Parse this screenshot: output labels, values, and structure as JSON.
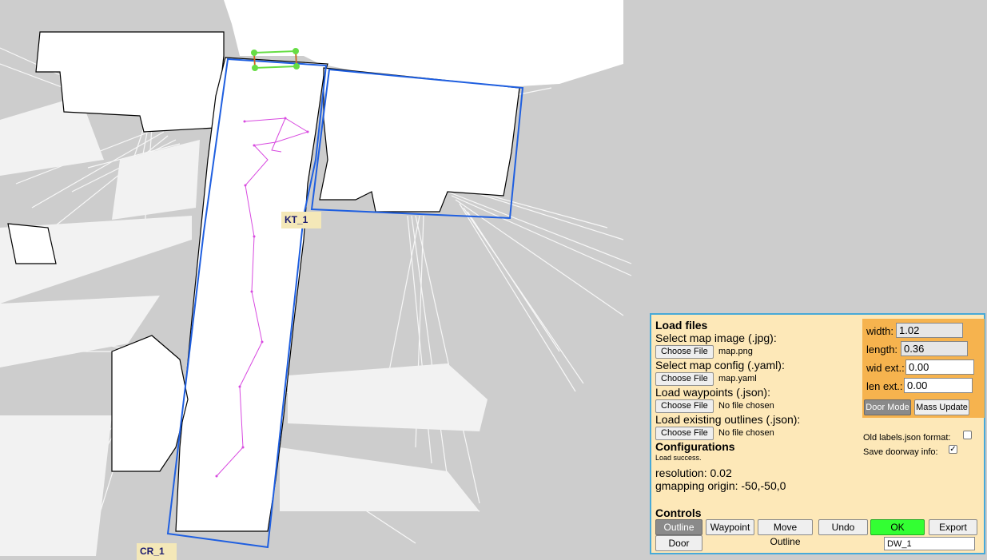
{
  "map": {
    "rooms": [
      {
        "label": "KT_1"
      },
      {
        "label": "CR_1"
      }
    ],
    "colors": {
      "outline": "#1f5fe0",
      "waypoints": "#d84ae0",
      "door": "#66dd44",
      "background": "#cdcdcd",
      "free_space": "#ffffff"
    }
  },
  "panel": {
    "load_files_title": "Load files",
    "map_image_label": "Select map image (.jpg):",
    "map_image_button": "Choose File",
    "map_image_file": "map.png",
    "map_config_label": "Select map config (.yaml):",
    "map_config_button": "Choose File",
    "map_config_file": "map.yaml",
    "waypoints_label": "Load waypoints (.json):",
    "waypoints_button": "Choose File",
    "waypoints_file": "No file chosen",
    "outlines_label": "Load existing outlines (.json):",
    "outlines_button": "Choose File",
    "outlines_file": "No file chosen",
    "config_title": "Configurations",
    "load_status": "Load success.",
    "resolution": "resolution: 0.02",
    "gmapping_origin": "gmapping origin: -50,-50,0",
    "controls_title": "Controls",
    "door": {
      "width_label": "width:",
      "width_value": "1.02",
      "length_label": "length:",
      "length_value": "0.36",
      "wid_ext_label": "wid ext.:",
      "wid_ext_value": "0.00",
      "len_ext_label": "len ext.:",
      "len_ext_value": "0.00",
      "door_mode_button": "Door Mode",
      "mass_update_button": "Mass Update"
    },
    "old_labels_label": "Old labels.json format:",
    "old_labels_checked": false,
    "save_doorway_label": "Save doorway info:",
    "save_doorway_checked": true,
    "buttons": {
      "outline": "Outline",
      "waypoint": "Waypoint",
      "move_outline": "Move Outline",
      "undo": "Undo",
      "ok": "OK",
      "export": "Export",
      "door": "Door"
    },
    "label_input_value": "DW_1"
  }
}
